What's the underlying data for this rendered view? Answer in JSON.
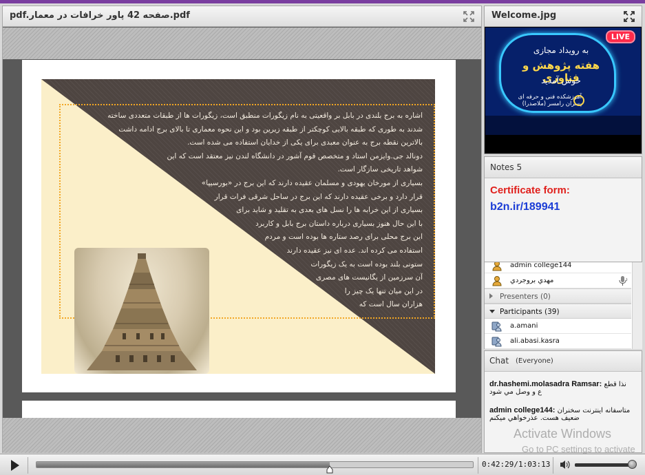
{
  "document_pod": {
    "title": "pdf.صفحه 42 پاور خرافات در معمار.pdf",
    "slide_lines": [
      "اشاره به برج بلندی در بابل بر واقعیتی به نام زیگورات منطبق است، زیگورات ها از طبقات متعددی ساخته",
      "شدند به طوری که طبقه بالایی کوچکتر از طبقه زیرین بود و این نحوه معماری تا بالای برج ادامه داشت",
      "بالاترین نقطه برج به عنوان معبدی برای یکی از خدایان استفاده می شده است.",
      "دونالد جی.وایزمن استاد و متخصص قوم آشور در دانشگاه لندن نیز معتقد است که این",
      "شواهد تاریخی سازگار است.",
      "بسیاری از مورخان یهودی و مسلمان عقیده دارند که این برج در «بورسیپا»",
      "قرار دارد و برخی عقیده دارند که این برج در ساحل شرقی فرات قرار",
      "بسیاری از این خرابه ها را نسل های بعدی به تقلید و شاید برای",
      "با این حال هنوز بسیاری درباره داستان برج بابل و کاربرد",
      "این برج محلی برای رصد ستاره ها بوده است و مردم",
      "استفاده می کرده اند. عده ای نیز عقیده دارند",
      "ستونی بلند بوده است به یک زیگورات",
      "آن سرزمین از یگانیست های مصری",
      "در این میان تنها یک چیز را",
      "هزاران سال است که"
    ]
  },
  "welcome_pod": {
    "title": "Welcome.jpg",
    "banner": {
      "live": "LIVE",
      "line1": "به رویداد مجازی",
      "line2": "هفته پژوهش و فناوری",
      "line3": "خوش آمدید",
      "line4": "آموزشکده فنی و حرفه ای پسران رامسر (ملاصدرا)"
    }
  },
  "notes_pod": {
    "title": "Notes 5",
    "line1": "Certificate form:",
    "line2": "b2n.ir/189941"
  },
  "attendees": {
    "hosts": [
      "admin college144",
      "مهدي بروجردي"
    ],
    "presenters_label": "Presenters (0)",
    "participants_label": "Participants (39)",
    "participants": [
      "a.amani",
      "ali.abasi.kasra"
    ]
  },
  "chat_pod": {
    "title": "Chat",
    "scope": "(Everyone)",
    "messages": [
      {
        "sender": "dr.hashemi.molasadra Ramsar:",
        "text_a": "نذا قطع",
        "text_b": "ع و وصل مي شود"
      },
      {
        "sender": "admin college144:",
        "text_a": "متاسفانه اینترنت سخنران",
        "text_b": "ضعیف هست. عذرخواهي میکنم"
      }
    ]
  },
  "watermark": {
    "line1": "Activate Windows",
    "line2": "Go to PC settings to activate"
  },
  "playback": {
    "time": "0:42:29/1:03:13",
    "progress_fraction": 0.672,
    "volume_fraction": 0.95
  },
  "colors": {
    "accent_top": "#7a3ea0",
    "note_red": "#e0201c",
    "note_blue": "#1a3cd6",
    "live_red": "#ff2a4a"
  },
  "icons": [
    "maximize-icon",
    "play-icon",
    "volume-icon",
    "host-icon",
    "participant-icon",
    "microphone-icon"
  ]
}
